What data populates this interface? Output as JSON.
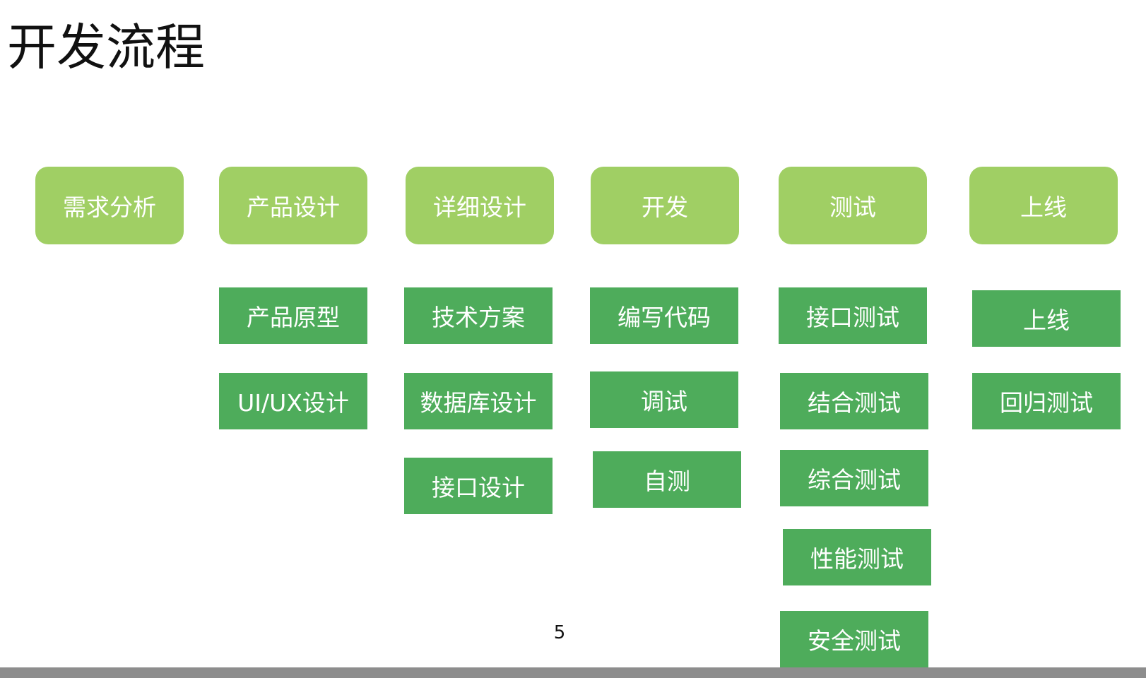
{
  "slide": {
    "title": "开发流程",
    "page_number": "5"
  },
  "phases": [
    {
      "label": "需求分析",
      "tasks": []
    },
    {
      "label": "产品设计",
      "tasks": [
        "产品原型",
        "UI/UX设计"
      ]
    },
    {
      "label": "详细设计",
      "tasks": [
        "技术方案",
        "数据库设计",
        "接口设计"
      ]
    },
    {
      "label": "开发",
      "tasks": [
        "编写代码",
        "调试",
        "自测"
      ]
    },
    {
      "label": "测试",
      "tasks": [
        "接口测试",
        "结合测试",
        "综合测试",
        "性能测试",
        "安全测试"
      ]
    },
    {
      "label": "上线",
      "tasks": [
        "上线",
        "回归测试"
      ]
    }
  ],
  "colors": {
    "phase_box": "#a0cf64",
    "task_box": "#4eac5b",
    "box_text": "#ffffff",
    "title_text": "#111111",
    "bottom_bar": "#8d8d8d"
  }
}
